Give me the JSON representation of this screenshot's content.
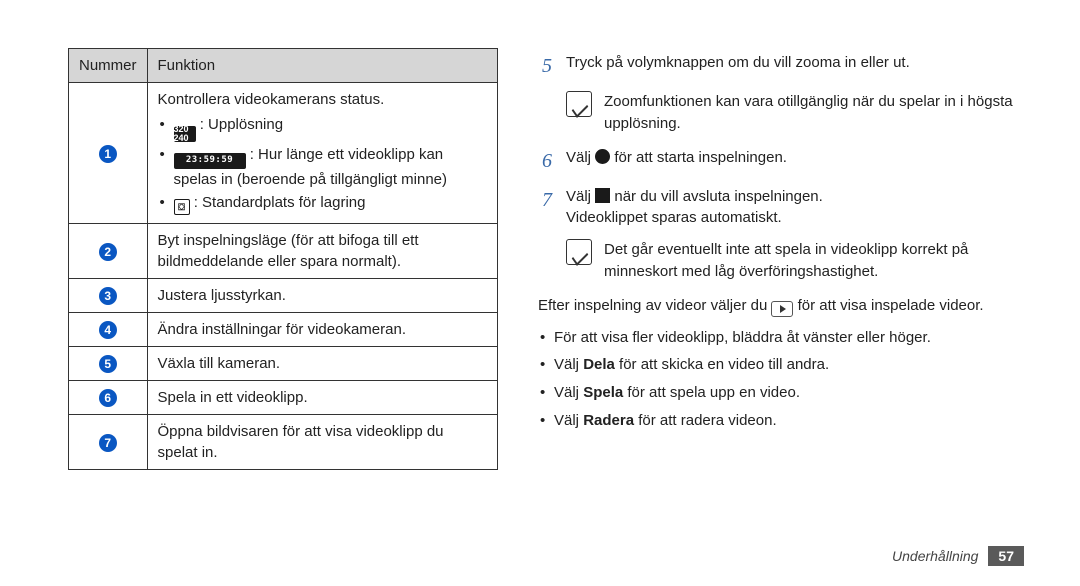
{
  "table": {
    "head_number": "Nummer",
    "head_function": "Funktion",
    "rows": [
      {
        "n": "1",
        "title": "Kontrollera videokamerans status.",
        "b1_icon": "320 240",
        "b1_text": " : Upplösning",
        "b2_icon": "23:59:59",
        "b2_text": " : Hur länge ett videoklipp kan spelas in (beroende på tillgängligt minne)",
        "b3_icon": "⛋",
        "b3_text": " : Standardplats för lagring"
      },
      {
        "n": "2",
        "text": "Byt inspelningsläge (för att bifoga till ett bildmeddelande eller spara normalt)."
      },
      {
        "n": "3",
        "text": "Justera ljusstyrkan."
      },
      {
        "n": "4",
        "text": "Ändra inställningar för videokameran."
      },
      {
        "n": "5",
        "text": "Växla till kameran."
      },
      {
        "n": "6",
        "text": "Spela in ett videoklipp."
      },
      {
        "n": "7",
        "text": "Öppna bildvisaren för att visa videoklipp du spelat in."
      }
    ]
  },
  "steps": {
    "s5": "Tryck på volymknappen om du vill zooma in eller ut.",
    "note1": "Zoomfunktionen kan vara otillgänglig när du spelar in i högsta upplösning.",
    "s6_a": "Välj ",
    "s6_b": " för att starta inspelningen.",
    "s7_a": "Välj ",
    "s7_b": " när du vill avsluta inspelningen.",
    "s7_c": "Videoklippet sparas automatiskt.",
    "note2": "Det går eventuellt inte att spela in videoklipp korrekt på minneskort med låg överföringshastighet."
  },
  "after_a": "Efter inspelning av videor väljer du ",
  "after_b": " för att visa inspelade videor.",
  "tips": {
    "t1": "För att visa fler videoklipp, bläddra åt vänster eller höger.",
    "t2_a": "Välj ",
    "t2_b": "Dela",
    "t2_c": " för att skicka en video till andra.",
    "t3_a": "Välj ",
    "t3_b": "Spela",
    "t3_c": " för att spela upp en video.",
    "t4_a": "Välj ",
    "t4_b": "Radera",
    "t4_c": " för att radera videon."
  },
  "footer": {
    "section": "Underhållning",
    "page": "57"
  }
}
